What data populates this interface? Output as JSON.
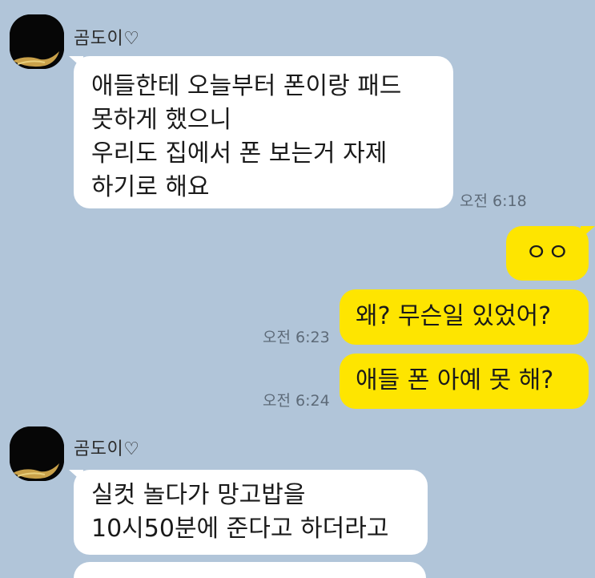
{
  "chat": {
    "messages": [
      {
        "sender": "곰도이♡",
        "direction": "incoming",
        "lines": [
          "애들한테 오늘부터 폰이랑 패드",
          "못하게 했으니",
          "우리도 집에서 폰 보는거 자제",
          "하기로 해요"
        ],
        "time": "오전 6:18"
      },
      {
        "direction": "outgoing",
        "text": "ㅇㅇ",
        "time": ""
      },
      {
        "direction": "outgoing",
        "text": "왜? 무슨일 있었어?",
        "time": "오전 6:23"
      },
      {
        "direction": "outgoing",
        "text": "애들 폰 아예 못 해?",
        "time": "오전 6:24"
      },
      {
        "sender": "곰도이♡",
        "direction": "incoming",
        "lines": [
          "실컷 놀다가 망고밥을",
          "10시50분에 준다고 하더라고"
        ],
        "time": ""
      }
    ]
  },
  "colors": {
    "background": "#b1c5d9",
    "incoming_bubble": "#ffffff",
    "outgoing_bubble": "#fee500",
    "timestamp": "#5d6a78"
  },
  "icons": {
    "avatar": "profile-photo-icon"
  }
}
